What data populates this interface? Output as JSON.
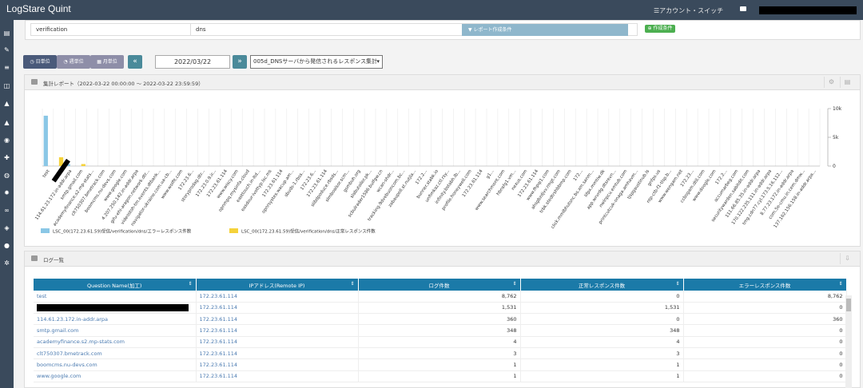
{
  "app": {
    "title": "LogStare Quint",
    "account_switch": "アカウント・スイッチ"
  },
  "condition": {
    "col1": "verification",
    "col2": "dns",
    "cond_button": "レポート作成条件",
    "create_button": "作成条件"
  },
  "toolbar": {
    "daily": "日単位",
    "weekly": "週単位",
    "monthly": "月単位",
    "prev": "«",
    "date": "2022/03/22",
    "next": "»",
    "report_select": "005d_DNSサーバから発信されるレスポンス集計"
  },
  "chart_panel": {
    "title": "集計レポート（2022-03-22 00:00:00 ～ 2022-03-22 23:59:59）"
  },
  "chart_data": {
    "type": "bar",
    "categories": [
      "test",
      "",
      "114.61.23.172.in-addr.arpa",
      "smtp.gmail.com",
      "academyfinance.s2.mp-stats...",
      "clt750307.bmetrack.com",
      "boomcms.nu-devs.com",
      "www.google.com",
      "4.207.250.142.in-addr.arpa",
      "gifu-ehi-aragon.network.dtr...",
      "videostsh-tm.events.dtbank...",
      "navigator-ukraine.com.ua-cb...",
      "www.wolfit.com",
      "172.23.6...",
      "storyprodag.dtr...",
      "172.23.0.9.ir...",
      "172.23.61.114",
      "www.wiscy.com",
      "opnmpq.mysinfa.cloud",
      "easttouch.in-ltd...",
      "easdour-ivottyp.lsc.ms",
      "172.23.61.114",
      "opnrsystes.wacup.am...",
      "sbuds-1.rbss...",
      "172.23.6...",
      "172.23.61.114",
      "slibdpoduce.rbsds...",
      "slmboalsor.scm...",
      "gsmbuh.org",
      "slabutoller.pk...",
      "scbulrader1586.bulfgw.cn",
      "wcan-shdr...",
      "tracking.9dvebuoncom.bc...",
      "zabaupell.st.nutjla...",
      "172.2...",
      "bunner.stabk.io",
      "unfimkaz.ctl.rsy...",
      "infinity.bstabh.lb...",
      "profile.honeywell.com",
      "172.23.61.114",
      "g1...",
      "www.searchmont.com",
      "hbnsfg1.vm...",
      "nexus.com",
      "172.23.61.114",
      "www.fhpqi1.com",
      "ahsgbzdjvv.rmgt.com",
      "trbk.stedtrshbbmp.com",
      "172...",
      "click.mmlbhutsnc.bs.xm.sanm...",
      "lifpx.mmtiw.dk",
      "app.wrvrdg.dtsrevn...",
      "nwlnpcu.emtub.com",
      "printcutcuk-onaga.amhavm...",
      "tjspgaustinub.ls",
      "gnfps.us",
      "ntp-ctb-f1-tlsp.b...",
      "www.wengam.net",
      "172.23...",
      "ccbogam.dtll.com",
      "www.doogle.com",
      "172.2...",
      "accumarbeg.com",
      "securitywarden.sabitdit.com",
      "111.66.85.35.in-addr.arpa",
      "170.122.235.111.in-addr.arpa",
      "tmg.cdn77.cyl.173.5.16.112...",
      "8.77.23.172.in-addr.arpa",
      "com.5e-cmu.in.cem.dmw...",
      "137.162.156.158.in-addr.arpa..."
    ],
    "series": [
      {
        "name": "LSC_00(172.23.61.59)受信/verification/dns/エラーレスポンス件数",
        "color": "#8ac7e6",
        "values": [
          8762,
          0,
          360,
          0,
          4,
          0,
          0,
          0,
          0,
          0,
          0,
          0,
          0,
          0,
          0,
          0,
          0,
          0,
          0,
          0,
          0,
          0,
          0,
          0,
          0,
          0,
          0,
          0,
          0,
          0,
          0,
          0,
          0,
          0,
          0,
          0,
          0,
          0,
          0,
          0,
          0,
          0,
          0,
          0,
          0,
          0,
          0,
          0,
          0,
          0,
          0,
          0,
          0,
          0,
          0,
          0,
          0,
          0,
          0,
          0,
          0,
          0,
          0,
          0,
          0,
          0,
          0,
          0,
          0,
          0
        ]
      },
      {
        "name": "LSC_00(172.23.61.59)受信/verification/dns/正常レスポンス件数",
        "color": "#f5d23a",
        "values": [
          0,
          1531,
          0,
          348,
          0,
          3,
          1,
          1,
          0,
          0,
          0,
          0,
          0,
          0,
          0,
          0,
          0,
          0,
          0,
          0,
          0,
          0,
          0,
          0,
          0,
          0,
          0,
          0,
          0,
          0,
          0,
          0,
          0,
          0,
          0,
          0,
          0,
          0,
          0,
          0,
          0,
          0,
          0,
          0,
          0,
          0,
          0,
          0,
          0,
          0,
          0,
          0,
          0,
          0,
          0,
          0,
          0,
          0,
          0,
          0,
          0,
          0,
          0,
          0,
          0,
          0,
          0,
          0,
          0,
          0
        ]
      }
    ],
    "y_ticks": [
      "10k",
      "5k",
      "0"
    ],
    "ylim": [
      0,
      10000
    ],
    "grid": true,
    "legend": "bottom-left"
  },
  "log_panel": {
    "title": "ログ一覧",
    "columns": [
      "Question Name(加工)",
      "IPアドレス(Remote IP)",
      "ログ件数",
      "正常レスポンス件数",
      "エラーレスポンス件数"
    ],
    "rows": [
      [
        "test",
        "172.23.61.114",
        "8,762",
        "0",
        "8,762"
      ],
      [
        "",
        "172.23.61.114",
        "1,531",
        "1,531",
        "0"
      ],
      [
        "114.61.23.172.in-addr.arpa",
        "172.23.61.114",
        "360",
        "0",
        "360"
      ],
      [
        "smtp.gmail.com",
        "172.23.61.114",
        "348",
        "348",
        "0"
      ],
      [
        "academyfinance.s2.mp-stats.com",
        "172.23.61.114",
        "4",
        "4",
        "0"
      ],
      [
        "clt750307.bmetrack.com",
        "172.23.61.114",
        "3",
        "3",
        "0"
      ],
      [
        "boomcms.nu-devs.com",
        "172.23.61.114",
        "1",
        "1",
        "0"
      ],
      [
        "www.google.com",
        "172.23.61.114",
        "1",
        "1",
        "0"
      ]
    ]
  }
}
